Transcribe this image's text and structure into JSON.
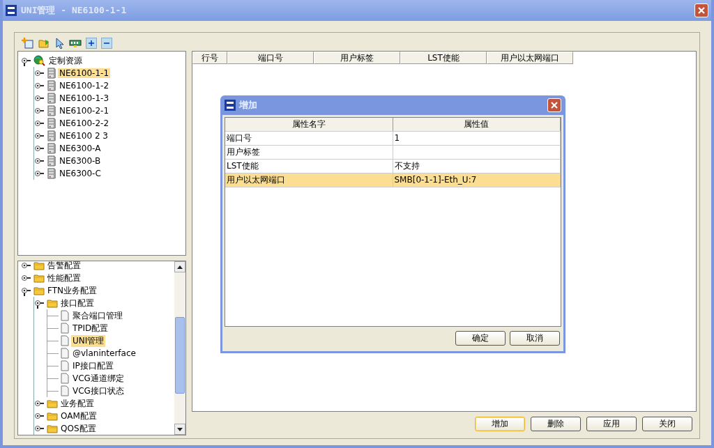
{
  "window": {
    "title": "UNI管理 - NE6100-1-1"
  },
  "resource_tree": [
    {
      "label": "定制资源",
      "kind": "root",
      "expanded": true,
      "selected": false,
      "children": [
        {
          "label": "NE6100-1-1",
          "kind": "ne",
          "selected": true
        },
        {
          "label": "NE6100-1-2",
          "kind": "ne",
          "selected": false
        },
        {
          "label": "NE6100-1-3",
          "kind": "ne",
          "selected": false
        },
        {
          "label": "NE6100-2-1",
          "kind": "ne",
          "selected": false
        },
        {
          "label": "NE6100-2-2",
          "kind": "ne",
          "selected": false
        },
        {
          "label": "NE6100 2 3",
          "kind": "ne",
          "selected": false
        },
        {
          "label": "NE6300-A",
          "kind": "ne",
          "selected": false
        },
        {
          "label": "NE6300-B",
          "kind": "ne",
          "selected": false
        },
        {
          "label": "NE6300-C",
          "kind": "ne",
          "selected": false
        }
      ]
    }
  ],
  "function_tree": [
    {
      "label": "告警配置",
      "kind": "folder",
      "expanded": false,
      "selected": false
    },
    {
      "label": "性能配置",
      "kind": "folder",
      "expanded": false,
      "selected": false
    },
    {
      "label": "FTN业务配置",
      "kind": "folder",
      "expanded": true,
      "selected": false,
      "children": [
        {
          "label": "接口配置",
          "kind": "folder",
          "expanded": true,
          "selected": false,
          "children": [
            {
              "label": "聚合端口管理",
              "kind": "page",
              "selected": false
            },
            {
              "label": "TPID配置",
              "kind": "page",
              "selected": false
            },
            {
              "label": "UNI管理",
              "kind": "page",
              "selected": true
            },
            {
              "label": "@vlaninterface",
              "kind": "page",
              "selected": false
            },
            {
              "label": "IP接口配置",
              "kind": "page",
              "selected": false
            },
            {
              "label": "VCG通道绑定",
              "kind": "page",
              "selected": false
            },
            {
              "label": "VCG接口状态",
              "kind": "page",
              "selected": false
            }
          ]
        },
        {
          "label": "业务配置",
          "kind": "folder",
          "expanded": false,
          "selected": false
        },
        {
          "label": "OAM配置",
          "kind": "folder",
          "expanded": false,
          "selected": false
        },
        {
          "label": "QOS配置",
          "kind": "folder",
          "expanded": false,
          "selected": false
        }
      ]
    }
  ],
  "table": {
    "columns": [
      "行号",
      "端口号",
      "用户标签",
      "LST使能",
      "用户以太网端口"
    ]
  },
  "buttons": [
    {
      "label": "增加",
      "focused": true
    },
    {
      "label": "删除",
      "focused": false
    },
    {
      "label": "应用",
      "focused": false
    },
    {
      "label": "关闭",
      "focused": false
    }
  ],
  "dialog": {
    "title": "增加",
    "columns": [
      "属性名字",
      "属性值"
    ],
    "rows": [
      {
        "name": "端口号",
        "value": "1",
        "selected": false
      },
      {
        "name": "用户标签",
        "value": "",
        "selected": false
      },
      {
        "name": "LST使能",
        "value": "不支持",
        "selected": false
      },
      {
        "name": "用户以太网端口",
        "value": "SMB[0-1-1]-Eth_U:7",
        "selected": true
      }
    ],
    "buttons": [
      "确定",
      "取消"
    ]
  }
}
